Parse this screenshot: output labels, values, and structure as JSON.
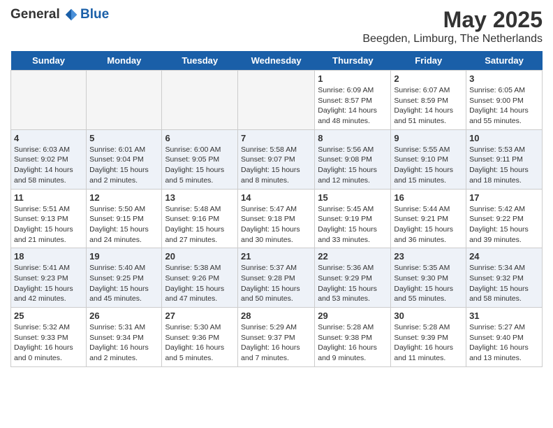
{
  "header": {
    "logo_general": "General",
    "logo_blue": "Blue",
    "month_title": "May 2025",
    "location": "Beegden, Limburg, The Netherlands"
  },
  "weekdays": [
    "Sunday",
    "Monday",
    "Tuesday",
    "Wednesday",
    "Thursday",
    "Friday",
    "Saturday"
  ],
  "weeks": [
    {
      "row_class": "norm-row",
      "days": [
        {
          "number": "",
          "info": "",
          "empty": true
        },
        {
          "number": "",
          "info": "",
          "empty": true
        },
        {
          "number": "",
          "info": "",
          "empty": true
        },
        {
          "number": "",
          "info": "",
          "empty": true
        },
        {
          "number": "1",
          "info": "Sunrise: 6:09 AM\nSunset: 8:57 PM\nDaylight: 14 hours\nand 48 minutes.",
          "empty": false
        },
        {
          "number": "2",
          "info": "Sunrise: 6:07 AM\nSunset: 8:59 PM\nDaylight: 14 hours\nand 51 minutes.",
          "empty": false
        },
        {
          "number": "3",
          "info": "Sunrise: 6:05 AM\nSunset: 9:00 PM\nDaylight: 14 hours\nand 55 minutes.",
          "empty": false
        }
      ]
    },
    {
      "row_class": "alt-row",
      "days": [
        {
          "number": "4",
          "info": "Sunrise: 6:03 AM\nSunset: 9:02 PM\nDaylight: 14 hours\nand 58 minutes.",
          "empty": false
        },
        {
          "number": "5",
          "info": "Sunrise: 6:01 AM\nSunset: 9:04 PM\nDaylight: 15 hours\nand 2 minutes.",
          "empty": false
        },
        {
          "number": "6",
          "info": "Sunrise: 6:00 AM\nSunset: 9:05 PM\nDaylight: 15 hours\nand 5 minutes.",
          "empty": false
        },
        {
          "number": "7",
          "info": "Sunrise: 5:58 AM\nSunset: 9:07 PM\nDaylight: 15 hours\nand 8 minutes.",
          "empty": false
        },
        {
          "number": "8",
          "info": "Sunrise: 5:56 AM\nSunset: 9:08 PM\nDaylight: 15 hours\nand 12 minutes.",
          "empty": false
        },
        {
          "number": "9",
          "info": "Sunrise: 5:55 AM\nSunset: 9:10 PM\nDaylight: 15 hours\nand 15 minutes.",
          "empty": false
        },
        {
          "number": "10",
          "info": "Sunrise: 5:53 AM\nSunset: 9:11 PM\nDaylight: 15 hours\nand 18 minutes.",
          "empty": false
        }
      ]
    },
    {
      "row_class": "norm-row",
      "days": [
        {
          "number": "11",
          "info": "Sunrise: 5:51 AM\nSunset: 9:13 PM\nDaylight: 15 hours\nand 21 minutes.",
          "empty": false
        },
        {
          "number": "12",
          "info": "Sunrise: 5:50 AM\nSunset: 9:15 PM\nDaylight: 15 hours\nand 24 minutes.",
          "empty": false
        },
        {
          "number": "13",
          "info": "Sunrise: 5:48 AM\nSunset: 9:16 PM\nDaylight: 15 hours\nand 27 minutes.",
          "empty": false
        },
        {
          "number": "14",
          "info": "Sunrise: 5:47 AM\nSunset: 9:18 PM\nDaylight: 15 hours\nand 30 minutes.",
          "empty": false
        },
        {
          "number": "15",
          "info": "Sunrise: 5:45 AM\nSunset: 9:19 PM\nDaylight: 15 hours\nand 33 minutes.",
          "empty": false
        },
        {
          "number": "16",
          "info": "Sunrise: 5:44 AM\nSunset: 9:21 PM\nDaylight: 15 hours\nand 36 minutes.",
          "empty": false
        },
        {
          "number": "17",
          "info": "Sunrise: 5:42 AM\nSunset: 9:22 PM\nDaylight: 15 hours\nand 39 minutes.",
          "empty": false
        }
      ]
    },
    {
      "row_class": "alt-row",
      "days": [
        {
          "number": "18",
          "info": "Sunrise: 5:41 AM\nSunset: 9:23 PM\nDaylight: 15 hours\nand 42 minutes.",
          "empty": false
        },
        {
          "number": "19",
          "info": "Sunrise: 5:40 AM\nSunset: 9:25 PM\nDaylight: 15 hours\nand 45 minutes.",
          "empty": false
        },
        {
          "number": "20",
          "info": "Sunrise: 5:38 AM\nSunset: 9:26 PM\nDaylight: 15 hours\nand 47 minutes.",
          "empty": false
        },
        {
          "number": "21",
          "info": "Sunrise: 5:37 AM\nSunset: 9:28 PM\nDaylight: 15 hours\nand 50 minutes.",
          "empty": false
        },
        {
          "number": "22",
          "info": "Sunrise: 5:36 AM\nSunset: 9:29 PM\nDaylight: 15 hours\nand 53 minutes.",
          "empty": false
        },
        {
          "number": "23",
          "info": "Sunrise: 5:35 AM\nSunset: 9:30 PM\nDaylight: 15 hours\nand 55 minutes.",
          "empty": false
        },
        {
          "number": "24",
          "info": "Sunrise: 5:34 AM\nSunset: 9:32 PM\nDaylight: 15 hours\nand 58 minutes.",
          "empty": false
        }
      ]
    },
    {
      "row_class": "norm-row",
      "days": [
        {
          "number": "25",
          "info": "Sunrise: 5:32 AM\nSunset: 9:33 PM\nDaylight: 16 hours\nand 0 minutes.",
          "empty": false
        },
        {
          "number": "26",
          "info": "Sunrise: 5:31 AM\nSunset: 9:34 PM\nDaylight: 16 hours\nand 2 minutes.",
          "empty": false
        },
        {
          "number": "27",
          "info": "Sunrise: 5:30 AM\nSunset: 9:36 PM\nDaylight: 16 hours\nand 5 minutes.",
          "empty": false
        },
        {
          "number": "28",
          "info": "Sunrise: 5:29 AM\nSunset: 9:37 PM\nDaylight: 16 hours\nand 7 minutes.",
          "empty": false
        },
        {
          "number": "29",
          "info": "Sunrise: 5:28 AM\nSunset: 9:38 PM\nDaylight: 16 hours\nand 9 minutes.",
          "empty": false
        },
        {
          "number": "30",
          "info": "Sunrise: 5:28 AM\nSunset: 9:39 PM\nDaylight: 16 hours\nand 11 minutes.",
          "empty": false
        },
        {
          "number": "31",
          "info": "Sunrise: 5:27 AM\nSunset: 9:40 PM\nDaylight: 16 hours\nand 13 minutes.",
          "empty": false
        }
      ]
    }
  ]
}
